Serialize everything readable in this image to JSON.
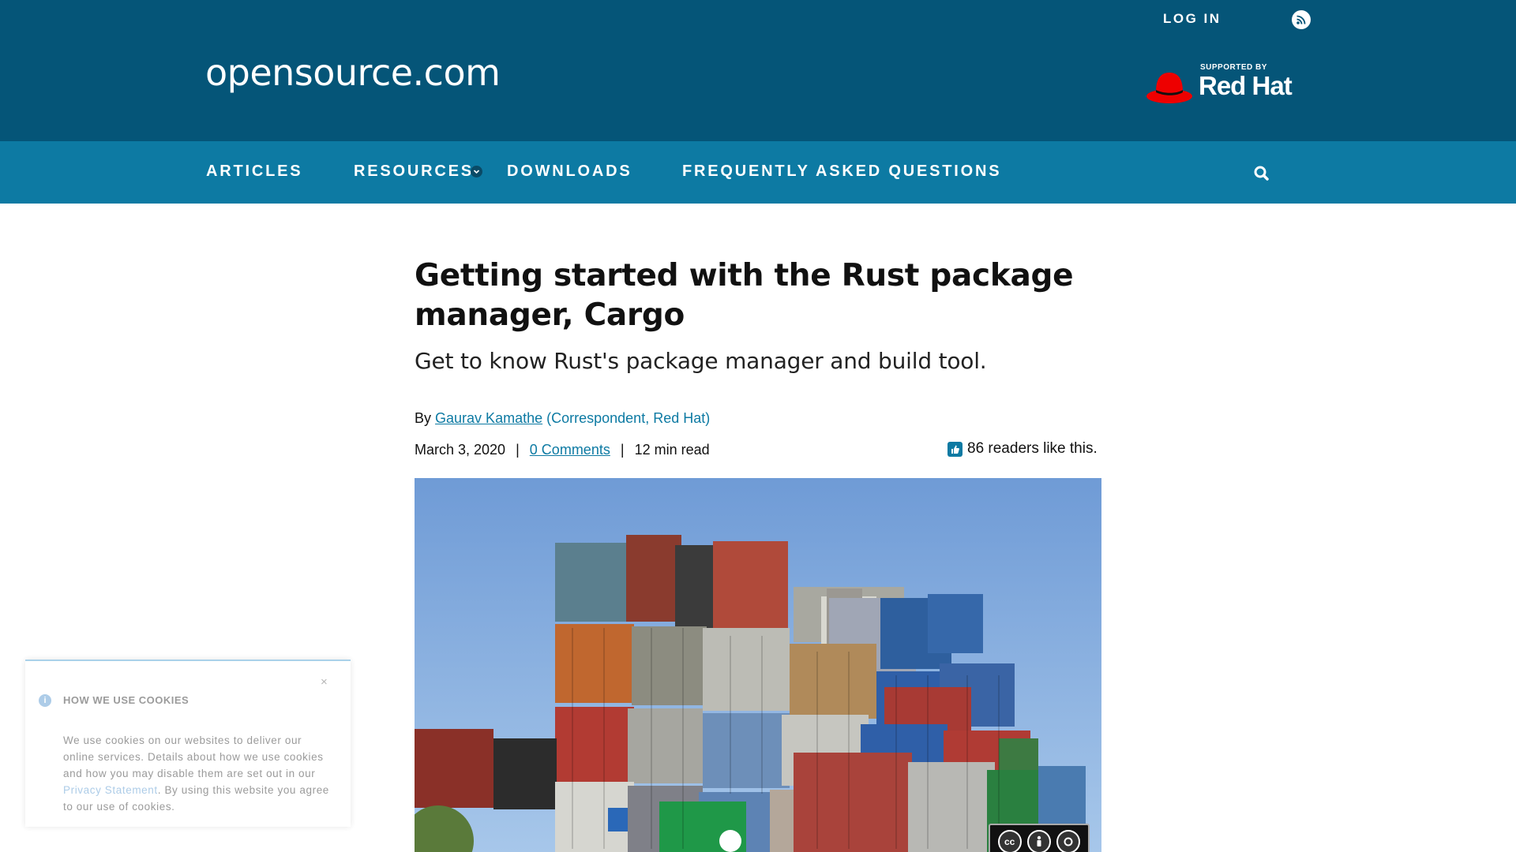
{
  "header": {
    "login_label": "LOG IN",
    "rss_icon": "rss-icon",
    "site_name": "opensource.com",
    "sponsor": {
      "supported_by": "SUPPORTED BY",
      "name": "Red Hat",
      "brand_color": "#ee0000"
    }
  },
  "nav": {
    "items": [
      {
        "label": "ARTICLES"
      },
      {
        "label": "RESOURCES"
      },
      {
        "label": "DOWNLOADS"
      },
      {
        "label": "FREQUENTLY ASKED QUESTIONS"
      }
    ],
    "search_icon": "search-icon"
  },
  "article": {
    "title": "Getting started with the Rust package manager, Cargo",
    "subtitle": "Get to know Rust's package manager and build tool.",
    "byline": {
      "by": "By",
      "author": "Gaurav Kamathe",
      "role": "(Correspondent, Red Hat)"
    },
    "meta": {
      "date": "March 3, 2020",
      "separator": "|",
      "comments": "0 Comments",
      "read_time": "12 min read"
    },
    "likes": "86 readers like this.",
    "license_badge": {
      "cc": "cc",
      "by": "BY",
      "sa": "SA"
    }
  },
  "cookie_banner": {
    "title": "HOW WE USE COOKIES",
    "body_before": "We use cookies on our websites to deliver our online services. Details about how we use cookies and how you may disable them are set out in our ",
    "link": "Privacy Statement",
    "body_after": ". By using this website you agree to our use of cookies.",
    "close": "×"
  },
  "colors": {
    "header_bg": "#055578",
    "nav_bg": "#0d7aa3",
    "link": "#0d7aa3"
  }
}
